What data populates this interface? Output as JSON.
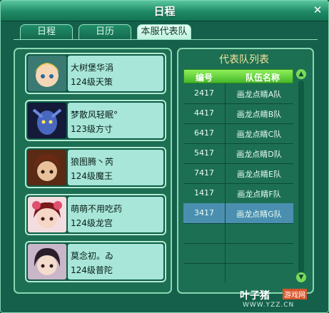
{
  "window": {
    "title": "日程",
    "close_symbol": "✕"
  },
  "tabs": [
    {
      "label": "日程",
      "active": false
    },
    {
      "label": "日历",
      "active": false
    },
    {
      "label": "本服代表队",
      "active": true
    }
  ],
  "members": [
    {
      "name": "大树堡华涓",
      "level": "124级天策"
    },
    {
      "name": "梦散风轻眠°",
      "level": "123级方寸"
    },
    {
      "name": "狼图腾丶芮",
      "level": "124级魔王"
    },
    {
      "name": "萌萌不用吃药",
      "level": "124级龙宫"
    },
    {
      "name": "莫念初。ゐ",
      "level": "124级普陀"
    }
  ],
  "team_list": {
    "title": "代表队列表",
    "headers": {
      "number": "编号",
      "team_name": "队伍名称"
    },
    "rows": [
      {
        "number": "2417",
        "team": "画龙点睛A队",
        "selected": false
      },
      {
        "number": "4417",
        "team": "画龙点睛B队",
        "selected": false
      },
      {
        "number": "6417",
        "team": "画龙点睛C队",
        "selected": false
      },
      {
        "number": "5417",
        "team": "画龙点睛D队",
        "selected": false
      },
      {
        "number": "7417",
        "team": "画龙点睛E队",
        "selected": false
      },
      {
        "number": "1417",
        "team": "画龙点睛F队",
        "selected": false
      },
      {
        "number": "3417",
        "team": "画龙点睛G队",
        "selected": true
      }
    ]
  },
  "watermark": {
    "brand": "叶子猪",
    "tag": "游戏网",
    "url": "WWW.YZZ.CN"
  },
  "colors": {
    "accent": "#1f8a66",
    "selected_row": "#4b8fb0",
    "header_green": "#46b829",
    "title_gold": "#f3e39a"
  }
}
